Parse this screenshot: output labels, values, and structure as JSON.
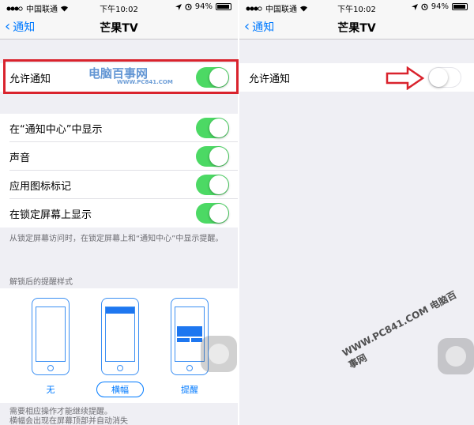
{
  "status_bar": {
    "carrier": "中国联通",
    "time": "下午10:02",
    "battery": "94%"
  },
  "nav": {
    "back_label": "通知",
    "title": "芒果TV"
  },
  "left": {
    "allow_notifications": {
      "label": "允许通知",
      "on": true
    },
    "settings": [
      {
        "label": "在“通知中心”中显示",
        "on": true
      },
      {
        "label": "声音",
        "on": true
      },
      {
        "label": "应用图标标记",
        "on": true
      },
      {
        "label": "在锁定屏幕上显示",
        "on": true
      }
    ],
    "footnote": "从锁定屏幕访问时，在锁定屏幕上和“通知中心”中显示提醒。",
    "alert_style_header": "解锁后的提醒样式",
    "alert_styles": [
      {
        "label": "无",
        "selected": false
      },
      {
        "label": "横幅",
        "selected": true
      },
      {
        "label": "提醒",
        "selected": false
      }
    ],
    "bottom_note_1": "需要相应操作才能继续提醒。",
    "bottom_note_2": "横幅会出现在屏幕顶部并自动消失"
  },
  "right": {
    "allow_notifications": {
      "label": "允许通知",
      "on": false
    }
  },
  "watermark": {
    "top_text": "电脑百事网",
    "top_sub": "WWW.PC841.COM",
    "bottom_text": "WWW.PC841.COM 电脑百事网"
  },
  "colors": {
    "toggle_on": "#4cd964",
    "ios_blue": "#007aff",
    "highlight_red": "#d9232d"
  }
}
